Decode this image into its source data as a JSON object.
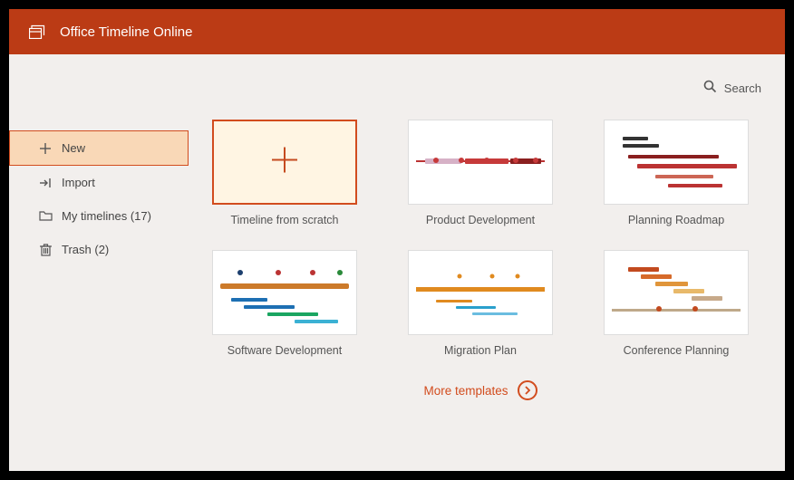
{
  "header": {
    "title": "Office Timeline Online"
  },
  "search": {
    "label": "Search"
  },
  "sidebar": {
    "items": [
      {
        "label": "New"
      },
      {
        "label": "Import"
      },
      {
        "label": "My timelines (17)"
      },
      {
        "label": "Trash (2)"
      }
    ]
  },
  "cards": {
    "scratch": {
      "label": "Timeline from scratch"
    },
    "product": {
      "label": "Product Development"
    },
    "roadmap": {
      "label": "Planning Roadmap"
    },
    "software": {
      "label": "Software Development"
    },
    "migration": {
      "label": "Migration Plan"
    },
    "conference": {
      "label": "Conference Planning"
    }
  },
  "more": {
    "label": "More templates"
  },
  "colors": {
    "brand": "#BB3B15",
    "accent": "#D24C1E"
  }
}
